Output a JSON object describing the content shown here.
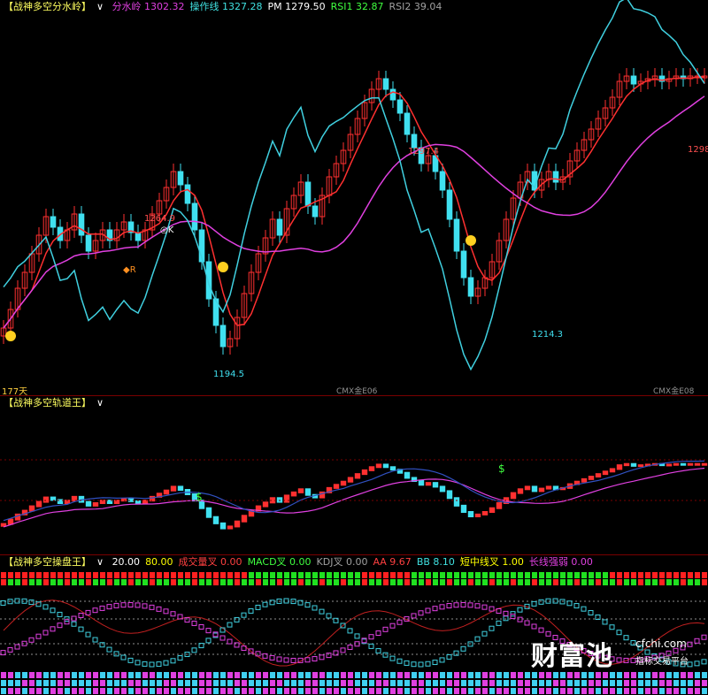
{
  "panel1": {
    "name": "【战神多空分水岭】",
    "dropdown": "∨",
    "items": [
      {
        "label": "分水岭",
        "value": "1302.32",
        "color": "#e040e0"
      },
      {
        "label": "操作线",
        "value": "1327.28",
        "color": "#40e0e0"
      },
      {
        "label": "PM",
        "value": "1279.50",
        "color": "#ffffff"
      },
      {
        "label": "RSI1",
        "value": "32.87",
        "color": "#40ff40"
      },
      {
        "label": "RSI2",
        "value": "39.04",
        "color": "#a0a0a0"
      }
    ],
    "annotations": {
      "high1": "1264.9",
      "low1": "1194.5",
      "high2": "1297.4",
      "low2": "1214.3",
      "high3": "1298",
      "days": "177天",
      "contract1": "CMX金E06",
      "contract2": "CMX金E08",
      "ok": "◎K",
      "r": "◆R"
    }
  },
  "panel2": {
    "name": "【战神多空轨道王】",
    "dropdown": "∨",
    "dollar": "$"
  },
  "panel3": {
    "name": "【战神多空操盘王】",
    "dropdown": "∨",
    "items": [
      {
        "label": "",
        "value": "20.00",
        "color": "#ffffff"
      },
      {
        "label": "",
        "value": "80.00",
        "color": "#ffff00"
      },
      {
        "label": "成交量叉",
        "value": "0.00",
        "color": "#ff4040"
      },
      {
        "label": "MACD叉",
        "value": "0.00",
        "color": "#40ff40"
      },
      {
        "label": "KDJ叉",
        "value": "0.00",
        "color": "#a0a0a0"
      },
      {
        "label": "AA",
        "value": "9.67",
        "color": "#ff4040"
      },
      {
        "label": "BB",
        "value": "8.10",
        "color": "#40e0e0"
      },
      {
        "label": "短中线叉",
        "value": "1.00",
        "color": "#ffff00"
      },
      {
        "label": "长线强弱",
        "value": "0.00",
        "color": "#e040e0"
      }
    ]
  },
  "watermark": {
    "brand": "财富池",
    "site": "cfchi.com",
    "tagline": "指标交易平台"
  },
  "colors": {
    "up": "#ff3030",
    "down": "#40e0f0",
    "magenta": "#e040e0",
    "green": "#40e040",
    "orange": "#ff9020",
    "bg": "#000000"
  },
  "chart_data": {
    "type": "candlestick",
    "bars": 100,
    "price_ylim": [
      1180,
      1320
    ],
    "close": [
      1203,
      1210,
      1218,
      1224,
      1231,
      1238,
      1245,
      1241,
      1236,
      1240,
      1246,
      1238,
      1232,
      1236,
      1240,
      1236,
      1240,
      1243,
      1239,
      1236,
      1240,
      1246,
      1251,
      1256,
      1262,
      1257,
      1250,
      1240,
      1228,
      1214,
      1204,
      1196,
      1199,
      1207,
      1216,
      1224,
      1231,
      1237,
      1244,
      1238,
      1248,
      1253,
      1258,
      1249,
      1245,
      1253,
      1260,
      1265,
      1270,
      1276,
      1282,
      1288,
      1293,
      1297,
      1293,
      1289,
      1284,
      1276,
      1271,
      1265,
      1268,
      1262,
      1255,
      1244,
      1232,
      1222,
      1215,
      1218,
      1222,
      1228,
      1236,
      1244,
      1252,
      1258,
      1262,
      1255,
      1259,
      1262,
      1258,
      1260,
      1266,
      1270,
      1274,
      1278,
      1282,
      1286,
      1290,
      1296,
      1298,
      1295,
      1296,
      1297,
      1298,
      1296,
      1297,
      1298,
      1297,
      1298,
      1298,
      1298
    ]
  }
}
